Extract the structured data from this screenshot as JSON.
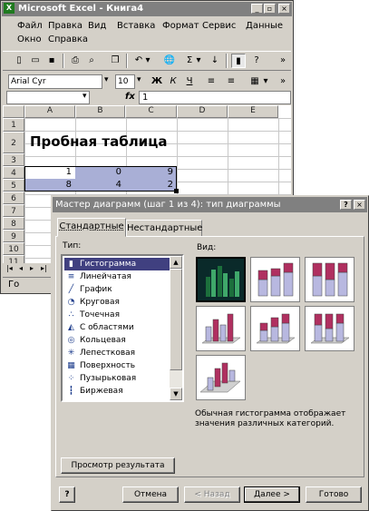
{
  "excel": {
    "title": "Microsoft Excel - Книга4",
    "menu_row1": [
      "Файл",
      "Правка",
      "Вид",
      "Вставка",
      "Формат",
      "Сервис",
      "Данные"
    ],
    "menu_row2": [
      "Окно",
      "Справка"
    ],
    "font_name": "Arial Cyr",
    "font_size": "10",
    "formula_value": "1",
    "fx": "fx",
    "sheet_tab": "Го",
    "columns": [
      "A",
      "B",
      "C",
      "D",
      "E"
    ],
    "rows": [
      "1",
      "2",
      "3",
      "4",
      "5",
      "6",
      "7",
      "8",
      "9",
      "10",
      "11"
    ],
    "cell_title": "Пробная таблица",
    "row4": [
      "1",
      "0",
      "9"
    ],
    "row5": [
      "8",
      "4",
      "2"
    ]
  },
  "dialog": {
    "title": "Мастер диаграмм (шаг 1 из 4): тип диаграммы",
    "help_btn": "?",
    "close_btn": "×",
    "tabs": [
      "Стандартные",
      "Нестандартные"
    ],
    "type_label": "Тип:",
    "view_label": "Вид:",
    "types": [
      {
        "label": "Гистограмма",
        "icon": "histogram-icon",
        "glyph": "▮"
      },
      {
        "label": "Линейчатая",
        "icon": "bar-chart-icon",
        "glyph": "≡"
      },
      {
        "label": "График",
        "icon": "line-chart-icon",
        "glyph": "╱"
      },
      {
        "label": "Круговая",
        "icon": "pie-chart-icon",
        "glyph": "◔"
      },
      {
        "label": "Точечная",
        "icon": "scatter-chart-icon",
        "glyph": "∴"
      },
      {
        "label": "С областями",
        "icon": "area-chart-icon",
        "glyph": "◭"
      },
      {
        "label": "Кольцевая",
        "icon": "donut-chart-icon",
        "glyph": "◎"
      },
      {
        "label": "Лепестковая",
        "icon": "radar-chart-icon",
        "glyph": "✳"
      },
      {
        "label": "Поверхность",
        "icon": "surface-chart-icon",
        "glyph": "▦"
      },
      {
        "label": "Пузырьковая",
        "icon": "bubble-chart-icon",
        "glyph": "⁘"
      },
      {
        "label": "Биржевая",
        "icon": "stock-chart-icon",
        "glyph": "┇"
      }
    ],
    "description": "Обычная гистограмма отображает значения различных категорий.",
    "preview_btn": "Просмотр результата",
    "buttons": [
      "Отмена",
      "< Назад",
      "Далее >",
      "Готово"
    ],
    "footer_help": "?"
  }
}
